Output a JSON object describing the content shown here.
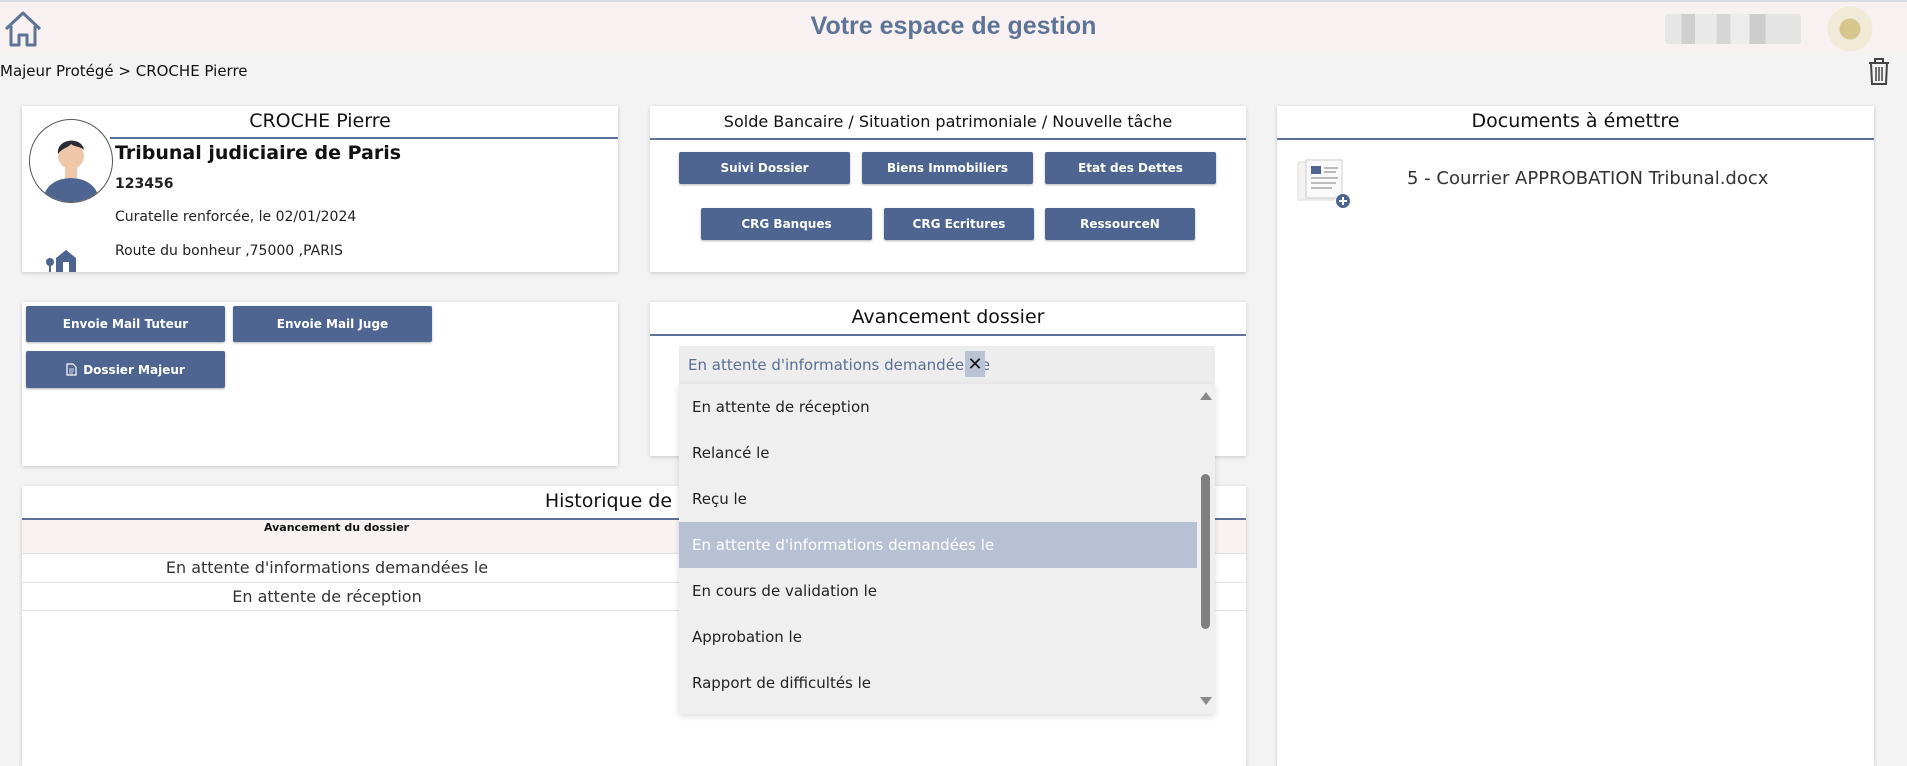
{
  "header": {
    "title": "Votre espace de gestion",
    "home_icon": "home-icon",
    "user_name_blurred": "",
    "accent_color": "#5f7396"
  },
  "breadcrumb": "Majeur Protégé > CROCHE Pierre",
  "person": {
    "name": "CROCHE Pierre",
    "court": "Tribunal judiciaire de Paris",
    "number": "123456",
    "measure": "Curatelle renforcée, le 02/01/2024",
    "address": "Route du bonheur ,75000 ,PARIS"
  },
  "solde": {
    "title": "Solde Bancaire / Situation patrimoniale / Nouvelle tâche",
    "buttons": [
      "Suivi Dossier",
      "Biens Immobiliers",
      "Etat des Dettes",
      "CRG Banques",
      "CRG Ecritures",
      "RessourceN"
    ]
  },
  "documents": {
    "title": "Documents à émettre",
    "items": [
      "5 - Courrier APPROBATION Tribunal.docx"
    ]
  },
  "mail": {
    "buttons": [
      "Envoie Mail Tuteur",
      "Envoie Mail Juge",
      "Dossier Majeur"
    ]
  },
  "avancement": {
    "title": "Avancement dossier",
    "selected": "En attente d'informations demandées le",
    "clear_symbol": "✕",
    "options": [
      "En attente de réception",
      "Relancé le",
      "Reçu le",
      "En attente d'informations demandées le",
      "En cours de validation le",
      "Approbation le",
      "Rapport de difficultés le"
    ],
    "selected_index": 3
  },
  "historique": {
    "title_visible": "Historique de l'ava",
    "column": "Avancement du dossier",
    "rows": [
      "En attente d'informations demandées le",
      "En attente de réception"
    ]
  },
  "colors": {
    "button": "#4d6590",
    "rule": "#5d7299",
    "selected_option": "#b8c1d4"
  }
}
